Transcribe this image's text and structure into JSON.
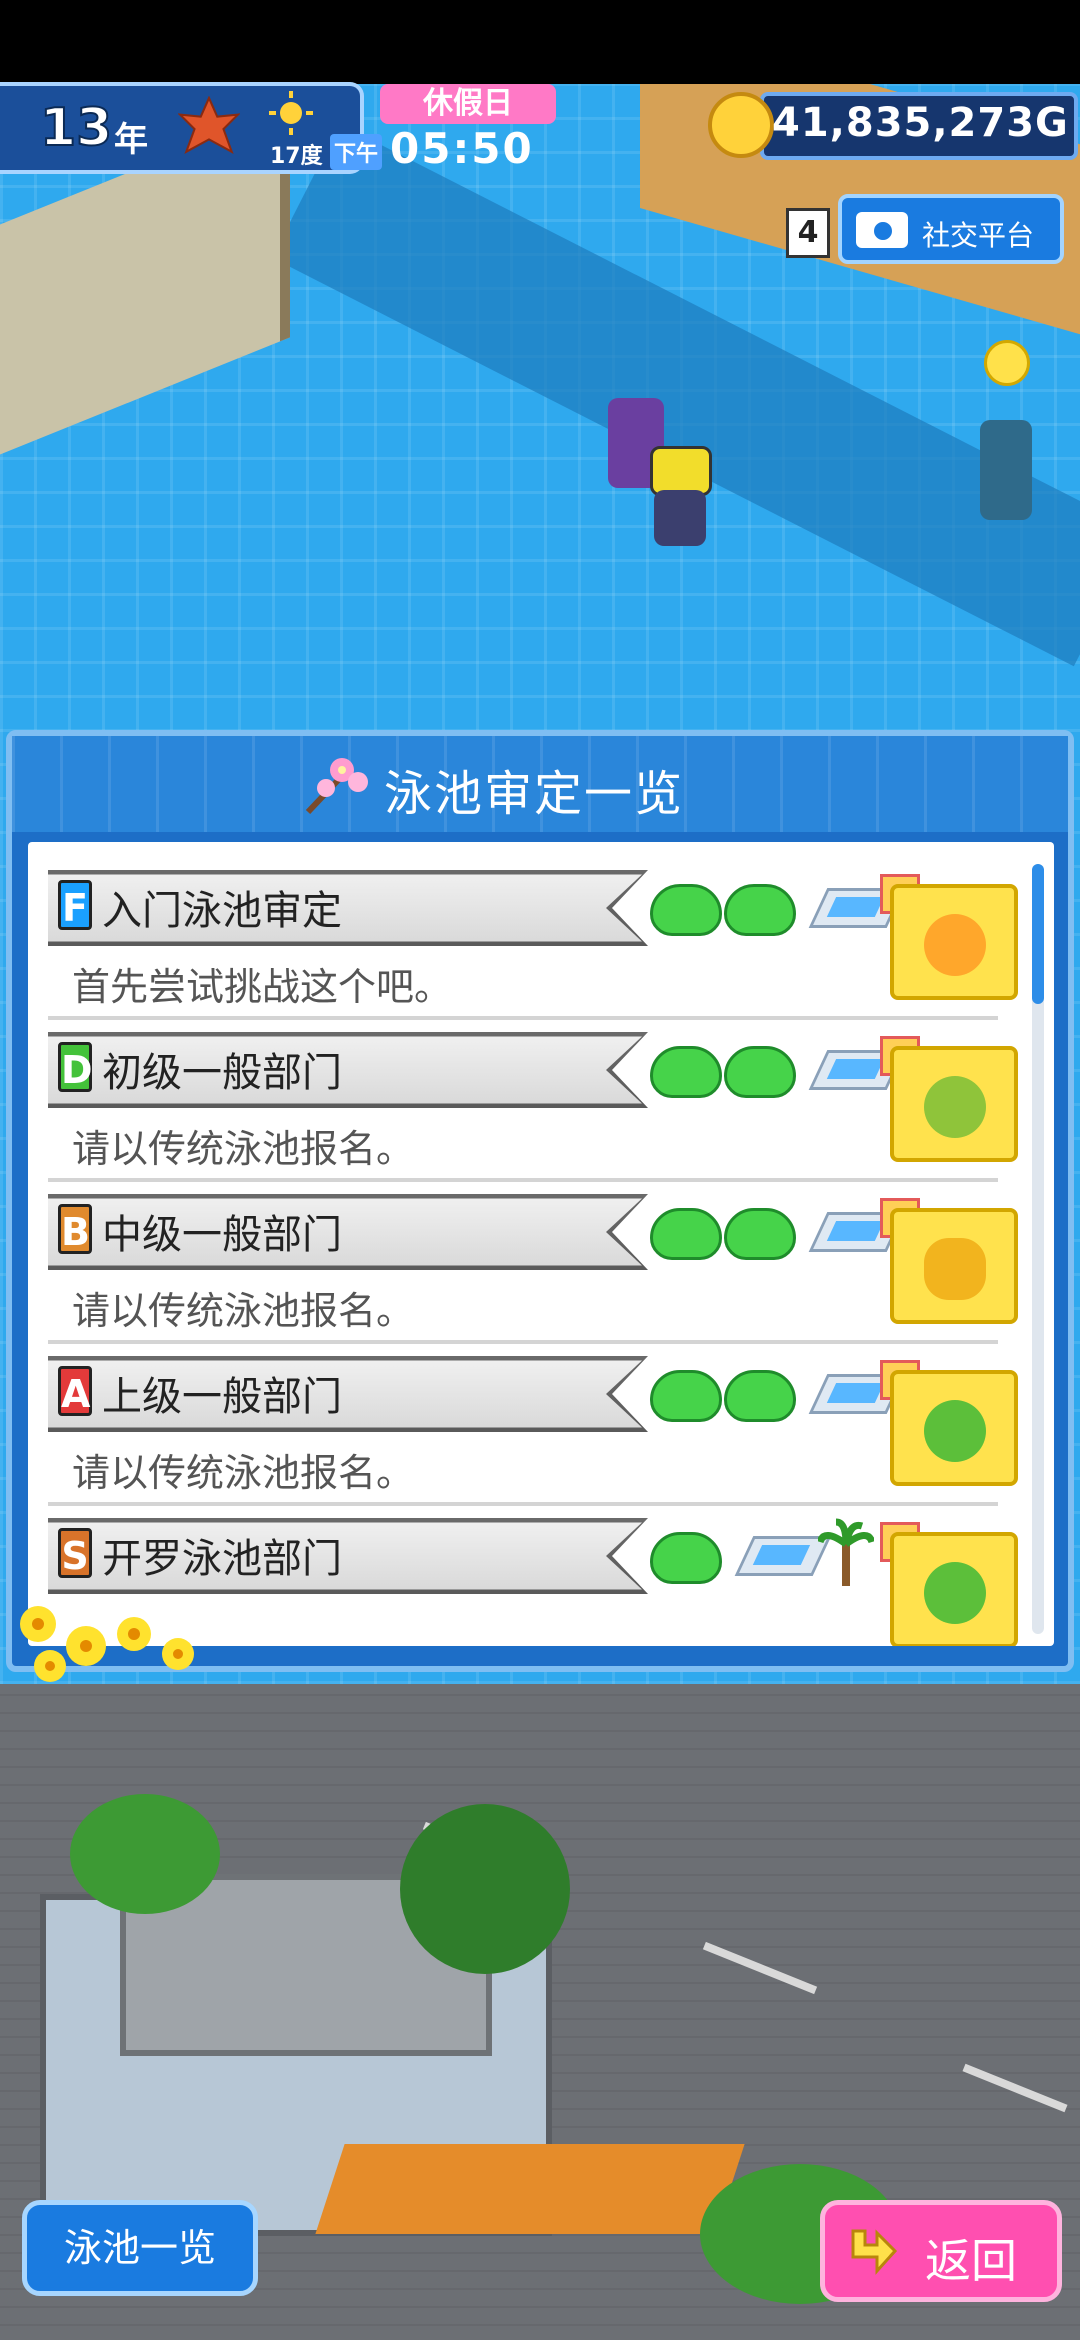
{
  "hud": {
    "year": "13",
    "year_unit": "年",
    "temperature": "17度",
    "holiday_label": "休假日",
    "period_label": "下午",
    "time": "05:50",
    "money": "41,835,273G",
    "notification_count": "4",
    "social_label": "社交平台"
  },
  "panel": {
    "title": "泳池审定一览",
    "items": [
      {
        "rank": "F",
        "rank_color": "#1aa0ff",
        "name": "入门泳池审定",
        "desc": "首先尝试挑战这个吧。",
        "reward": "orange-fruit-icon"
      },
      {
        "rank": "D",
        "rank_color": "#44c23a",
        "name": "初级一般部门",
        "desc": "请以传统泳池报名。",
        "reward": "green-fruit-icon"
      },
      {
        "rank": "B",
        "rank_color": "#e08a2e",
        "name": "中级一般部门",
        "desc": "请以传统泳池报名。",
        "reward": "pineapple-icon"
      },
      {
        "rank": "A",
        "rank_color": "#e33a3a",
        "name": "上级一般部门",
        "desc": "请以传统泳池报名。",
        "reward": "melon-icon"
      },
      {
        "rank": "S",
        "rank_color": "#d8732a",
        "name": "开罗泳池部门",
        "desc": "",
        "reward": "melon-icon"
      }
    ]
  },
  "buttons": {
    "pool_list": "泳池一览",
    "back": "返回"
  }
}
